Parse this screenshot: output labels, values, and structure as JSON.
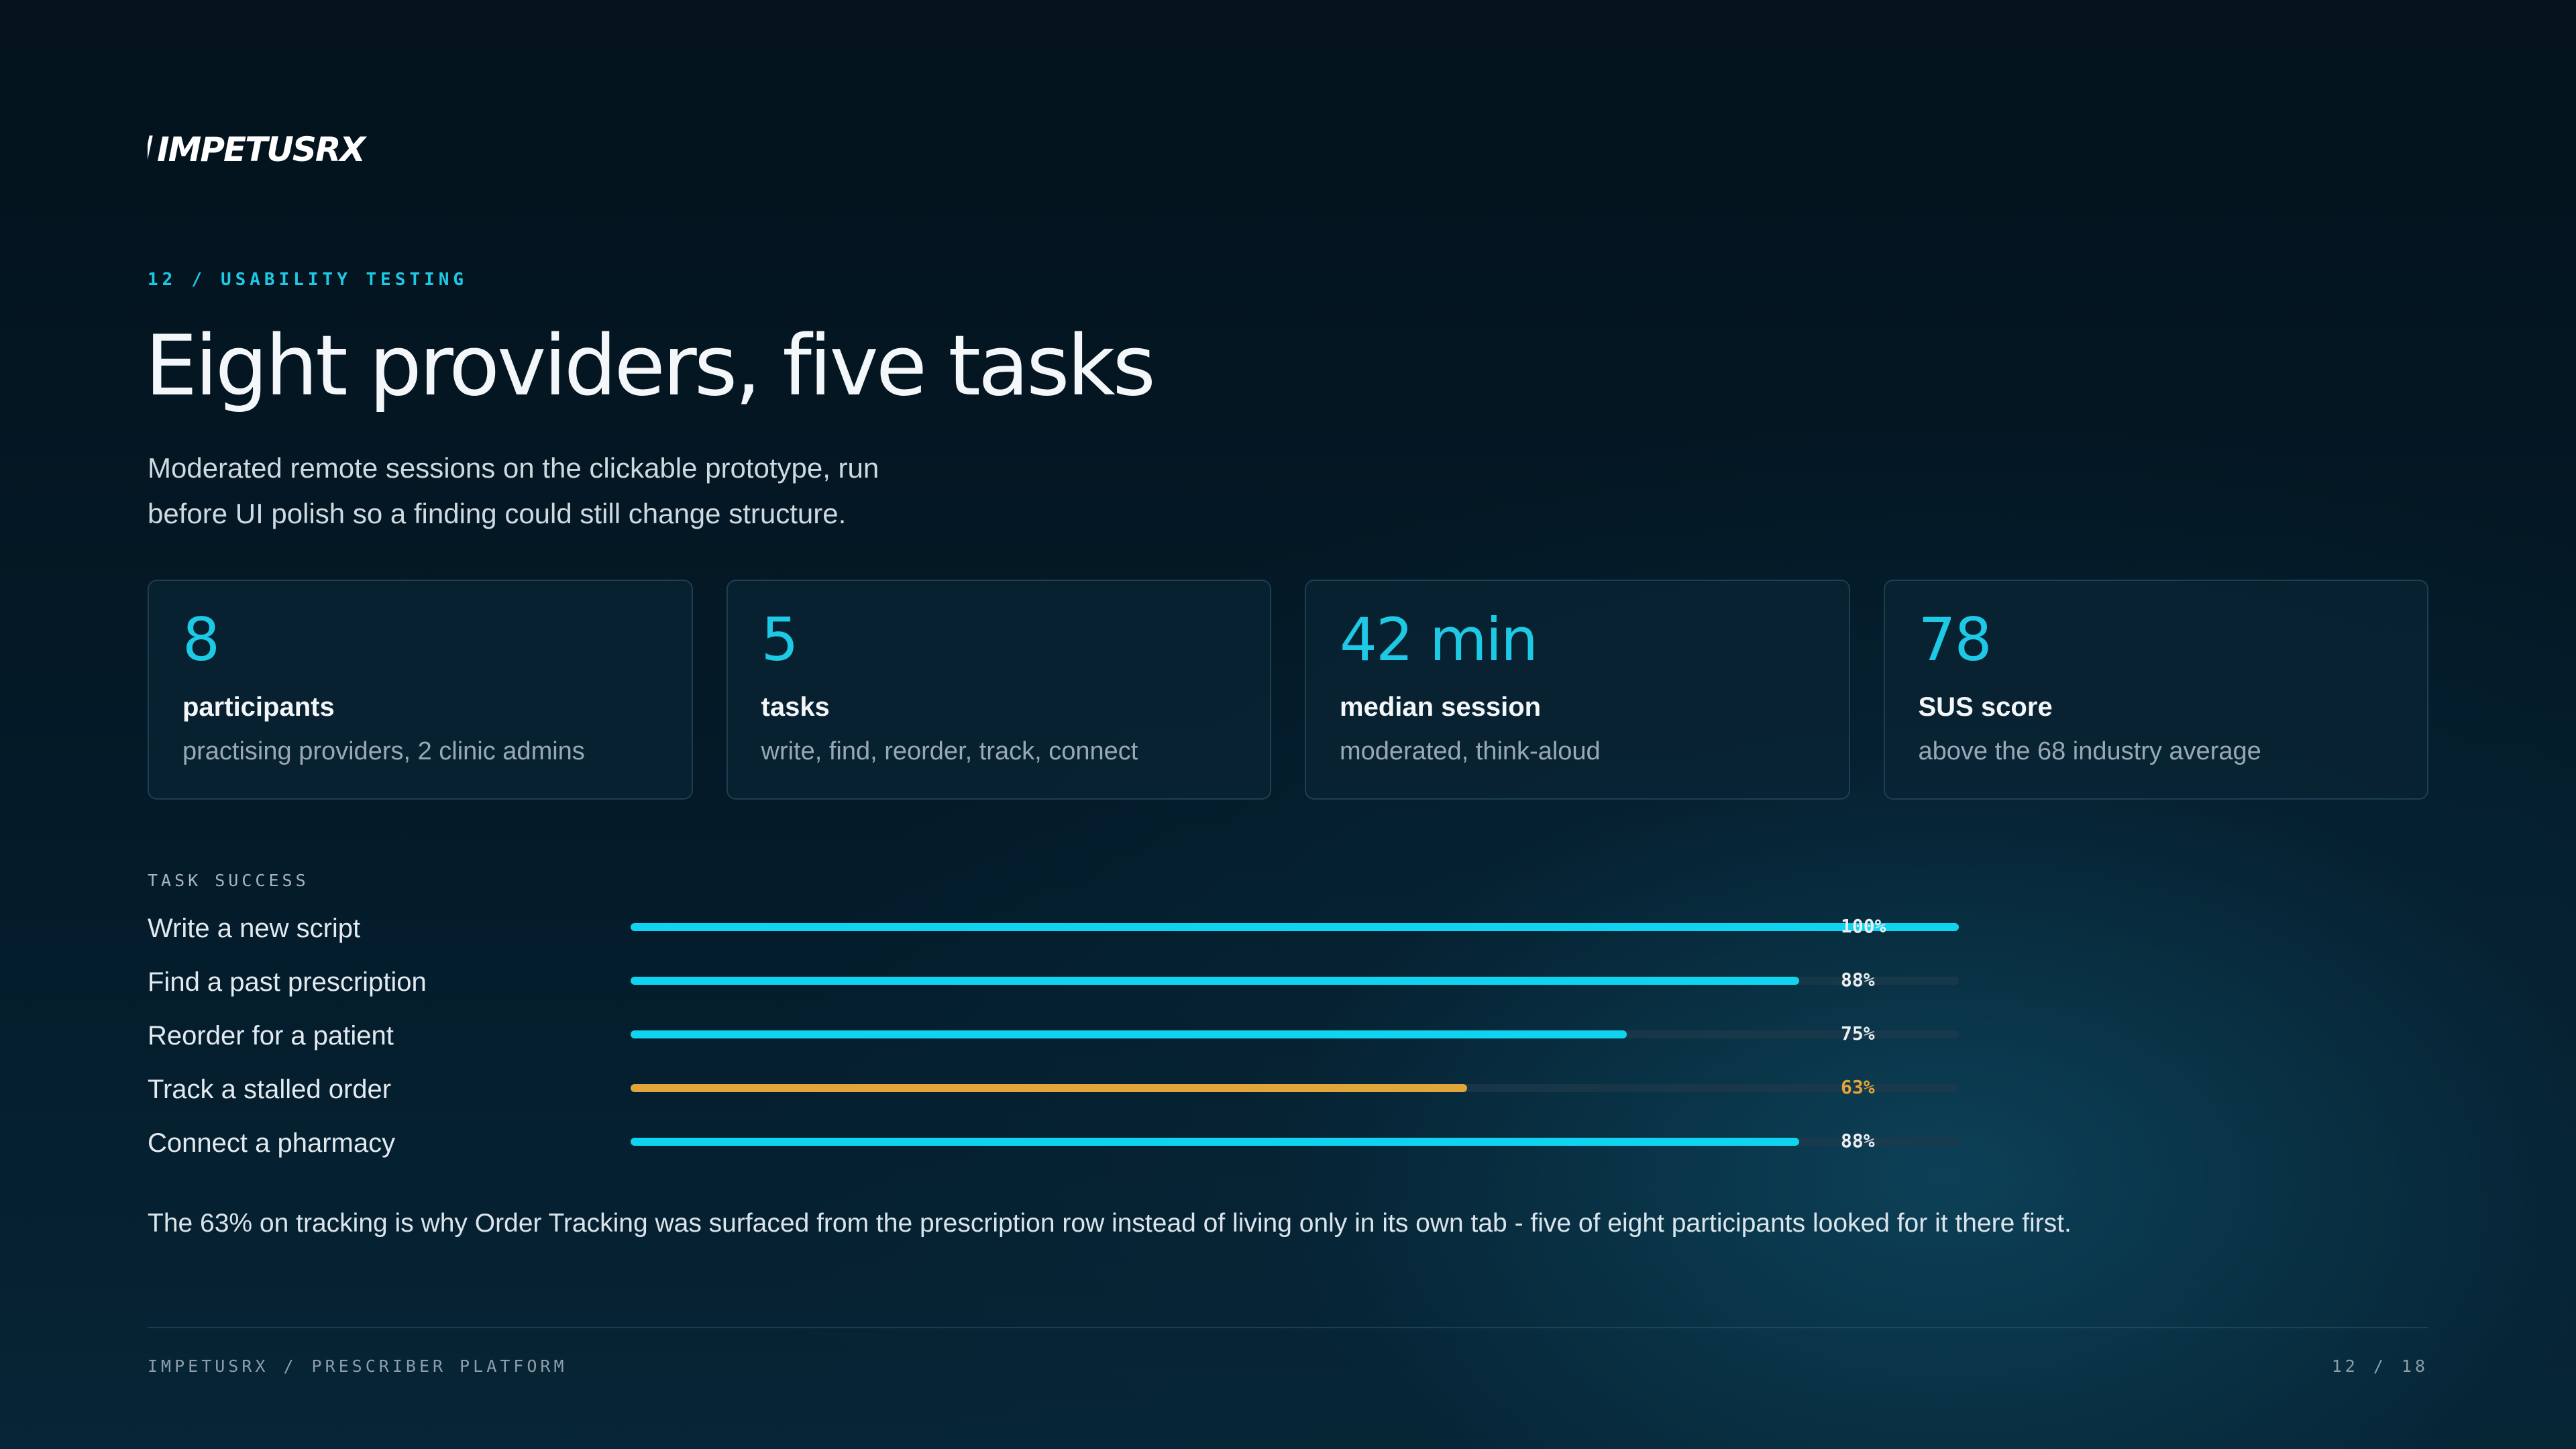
{
  "brand": {
    "logo_text": "IMPETUSRX"
  },
  "eyebrow": {
    "number": "12",
    "separator": "/",
    "section": "USABILITY TESTING"
  },
  "title": "Eight providers, five tasks",
  "subtitle": "Moderated remote sessions on the clickable prototype, run before UI polish so a finding could still change structure.",
  "stats": [
    {
      "value": "8",
      "label": "participants",
      "desc": "practising providers, 2 clinic admins"
    },
    {
      "value": "5",
      "label": "tasks",
      "desc": "write, find, reorder, track, connect"
    },
    {
      "value": "42 min",
      "label": "median session",
      "desc": "moderated, think-aloud"
    },
    {
      "value": "78",
      "label": "SUS score",
      "desc": "above the 68 industry average"
    }
  ],
  "task_section_label": "TASK SUCCESS",
  "tasks": [
    {
      "name": "Write a new script",
      "value": 100,
      "pct_label": "100%",
      "status": "normal"
    },
    {
      "name": "Find a past prescription",
      "value": 88,
      "pct_label": "88%",
      "status": "normal"
    },
    {
      "name": "Reorder for a patient",
      "value": 75,
      "pct_label": "75%",
      "status": "normal"
    },
    {
      "name": "Track a stalled order",
      "value": 63,
      "pct_label": "63%",
      "status": "warn"
    },
    {
      "name": "Connect a pharmacy",
      "value": 88,
      "pct_label": "88%",
      "status": "normal"
    }
  ],
  "note": "The 63% on tracking is why Order Tracking was surfaced from the prescription row instead of living only in its own tab - five of eight participants looked for it there first.",
  "footer": {
    "brand": "IMPETUSRX",
    "separator": "/",
    "product": "PRESCRIBER PLATFORM",
    "page_current": "12",
    "page_total": "18"
  },
  "colors": {
    "accent": "#10d3f0",
    "warn": "#e0a63c",
    "background": "#03121c"
  }
}
